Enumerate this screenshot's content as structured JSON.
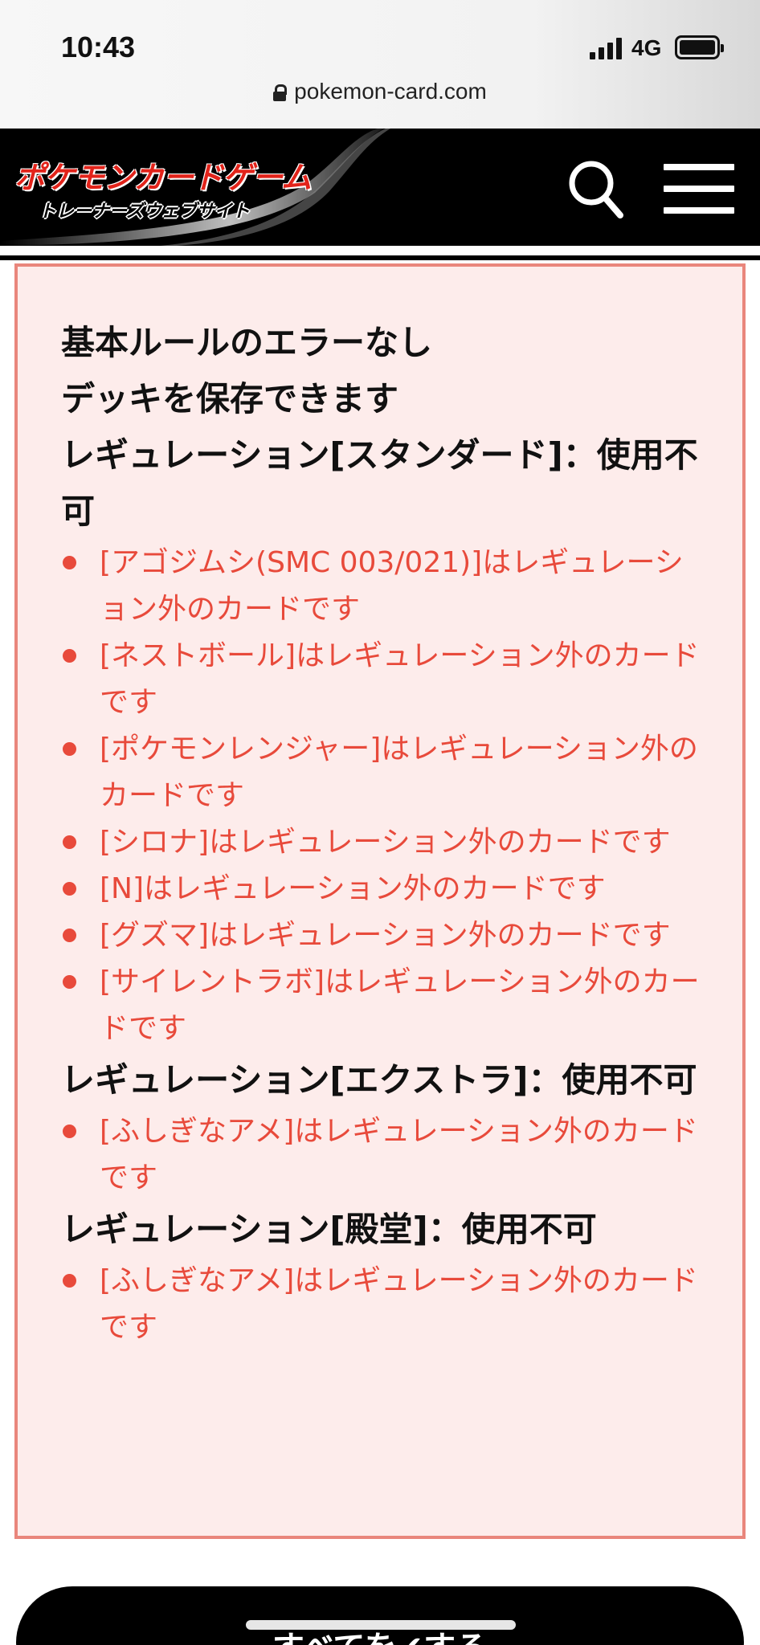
{
  "status_bar": {
    "time": "10:43",
    "network": "4G"
  },
  "browser": {
    "url": "pokemon-card.com"
  },
  "site": {
    "logo_title": "ポケモンカードゲーム",
    "logo_subtitle": "トレーナーズウェブサイト",
    "accent_color": "#e2231a"
  },
  "error_panel": {
    "border_color": "#e9867c",
    "background_color": "#fdeceb",
    "error_text_color": "#e84a3b",
    "basic_rule": "基本ルールのエラーなし",
    "save_status": "デッキを保存できます",
    "regulations": [
      {
        "heading": "レギュレーション[スタンダード]：使用不可",
        "errors": [
          "[アゴジムシ(SMC 003/021)]はレギュレーション外のカードです",
          "[ネストボール]はレギュレーション外のカードです",
          "[ポケモンレンジャー]はレギュレーション外のカードです",
          "[シロナ]はレギュレーション外のカードです",
          "[N]はレギュレーション外のカードです",
          "[グズマ]はレギュレーション外のカードです",
          "[サイレントラボ]はレギュレーション外のカードです"
        ]
      },
      {
        "heading": "レギュレーション[エクストラ]：使用不可",
        "errors": [
          "[ふしぎなアメ]はレギュレーション外のカードです"
        ]
      },
      {
        "heading": "レギュレーション[殿堂]：使用不可",
        "errors": [
          "[ふしぎなアメ]はレギュレーション外のカードです"
        ]
      }
    ]
  },
  "bottom_button": {
    "label": "すべてを✔する"
  }
}
